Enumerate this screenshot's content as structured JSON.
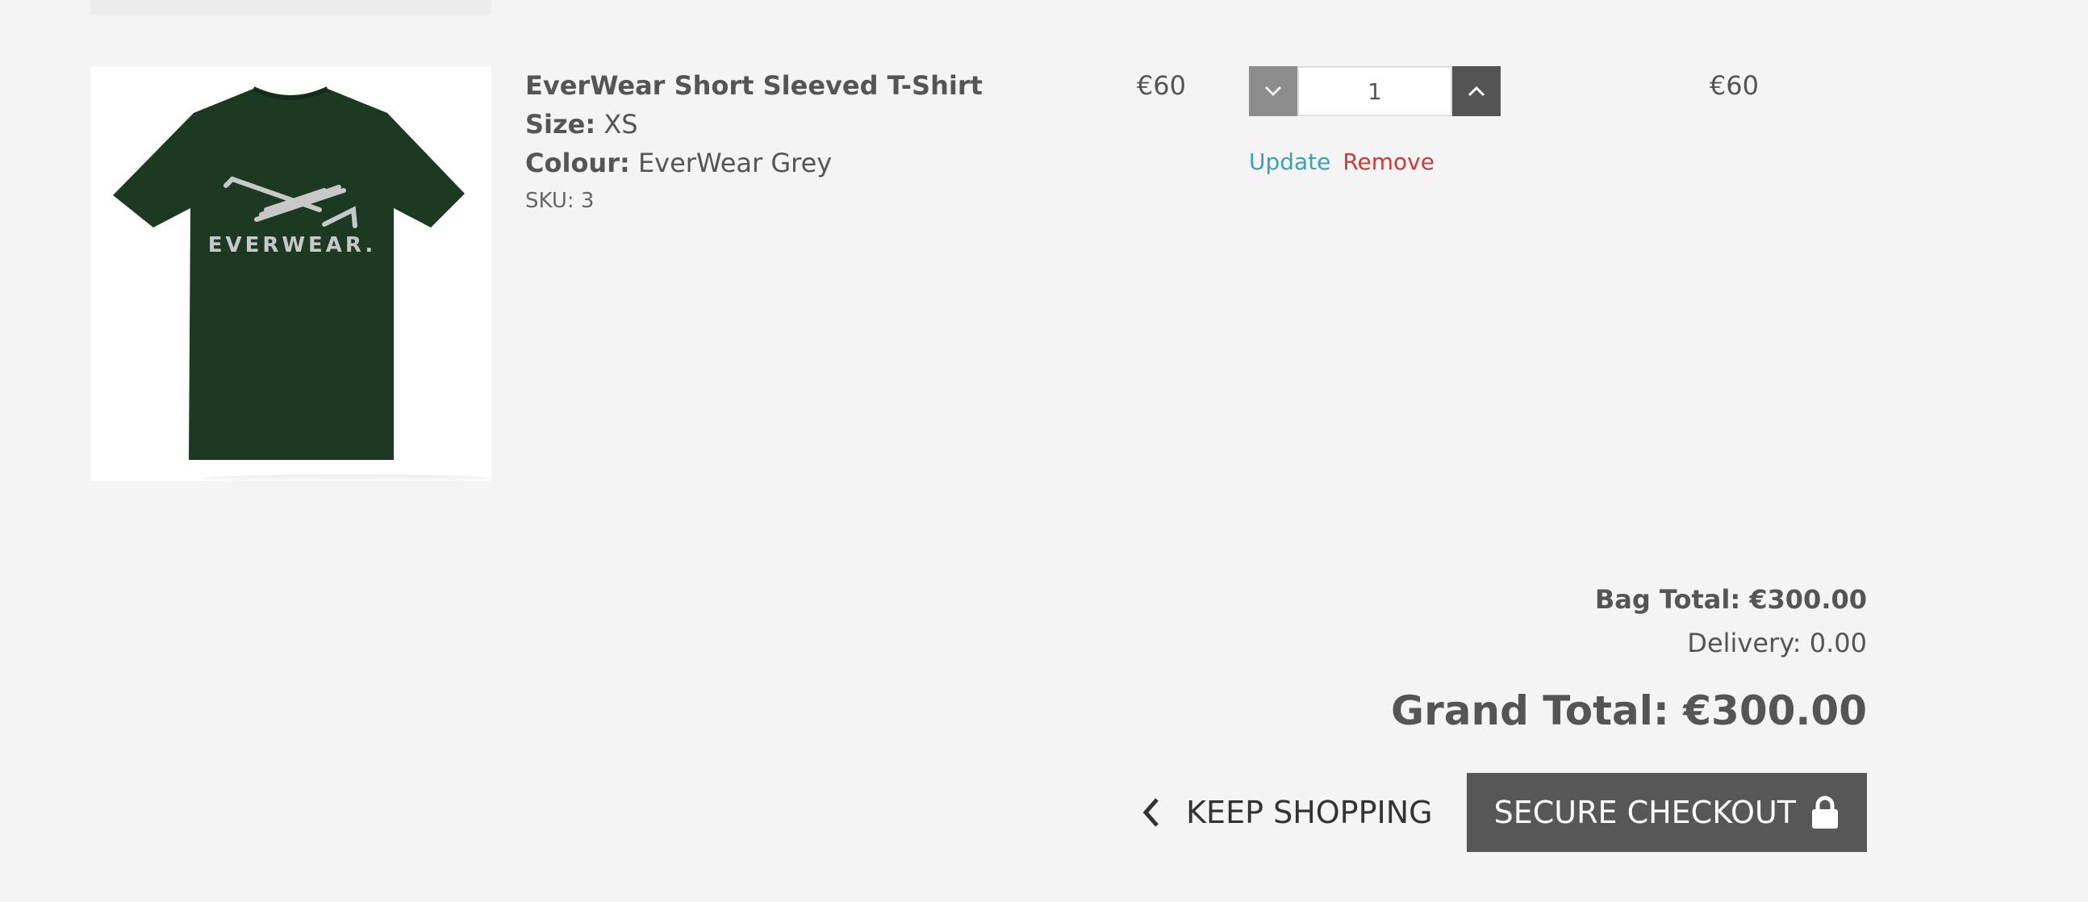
{
  "item": {
    "name": "EverWear Short Sleeved T-Shirt",
    "size_label": "Size:",
    "size_value": "XS",
    "colour_label": "Colour:",
    "colour_value": "EverWear Grey",
    "sku": "SKU: 3",
    "image_brand_text": "EVERWEAR.",
    "image_shirt_color": "#1c3a22",
    "unit_price": "€60",
    "quantity": "1",
    "line_total": "€60",
    "update_label": "Update",
    "remove_label": "Remove"
  },
  "summary": {
    "bag_total": "Bag Total: €300.00",
    "delivery": "Delivery: 0.00",
    "grand_total": "Grand Total: €300.00"
  },
  "actions": {
    "keep_shopping_label": "KEEP SHOPPING",
    "checkout_label": "SECURE CHECKOUT"
  },
  "icons": {
    "decrement": "chevron-down-icon",
    "increment": "chevron-up-icon",
    "back": "chevron-left-icon",
    "lock": "lock-icon"
  },
  "colors": {
    "accent_link": "#3aa3ad",
    "danger_link": "#cc3a3a",
    "button_dark": "#575757"
  }
}
